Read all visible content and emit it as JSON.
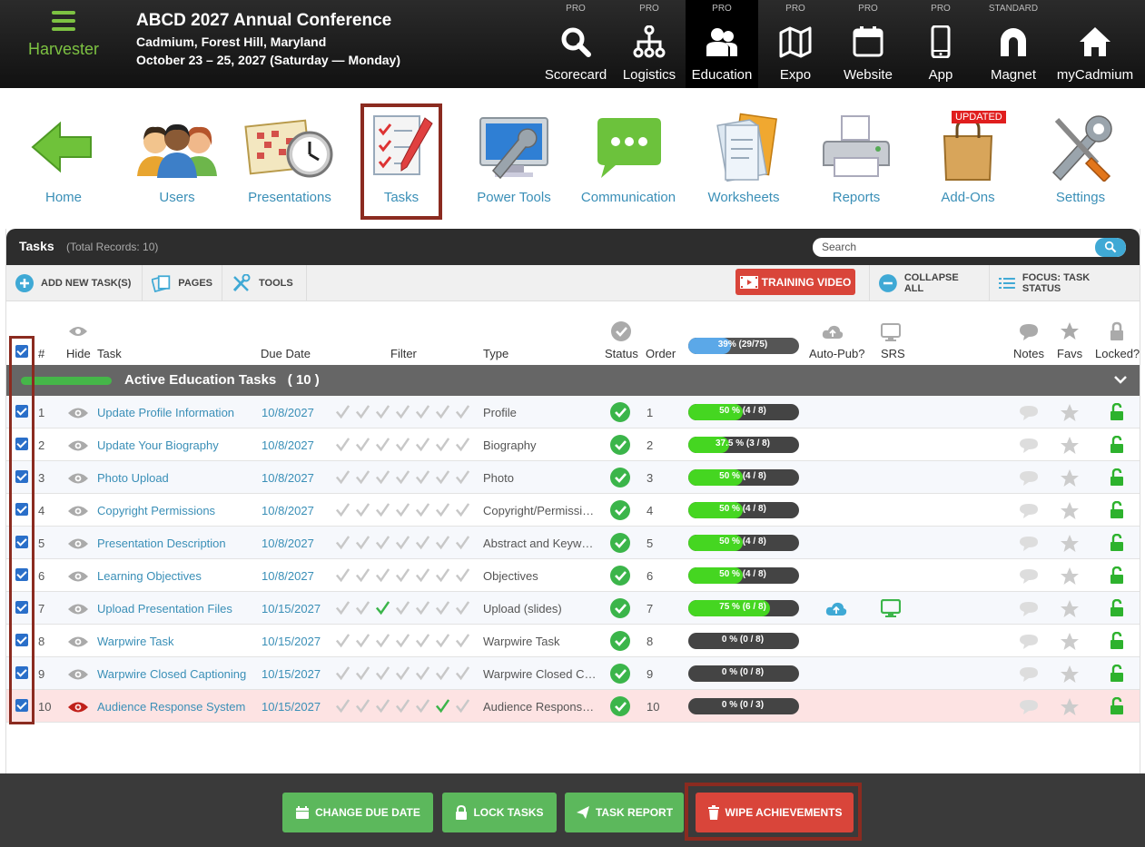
{
  "app": {
    "name": "Harvester"
  },
  "conference": {
    "title": "ABCD 2027 Annual Conference",
    "location": "Cadmium, Forest Hill, Maryland",
    "dates": "October 23 – 25, 2027 (Saturday — Monday)"
  },
  "modules": [
    {
      "tier": "PRO",
      "label": "Scorecard",
      "icon": "search-icon"
    },
    {
      "tier": "PRO",
      "label": "Logistics",
      "icon": "org-chart-icon"
    },
    {
      "tier": "PRO",
      "label": "Education",
      "icon": "people-icon"
    },
    {
      "tier": "PRO",
      "label": "Expo",
      "icon": "map-icon"
    },
    {
      "tier": "PRO",
      "label": "Website",
      "icon": "browser-icon"
    },
    {
      "tier": "PRO",
      "label": "App",
      "icon": "phone-icon"
    },
    {
      "tier": "STANDARD",
      "label": "Magnet",
      "icon": "magnet-icon"
    },
    {
      "tier": "",
      "label": "myCadmium",
      "icon": "home-icon"
    }
  ],
  "nav": [
    {
      "label": "Home"
    },
    {
      "label": "Users"
    },
    {
      "label": "Presentations"
    },
    {
      "label": "Tasks"
    },
    {
      "label": "Power Tools"
    },
    {
      "label": "Communication"
    },
    {
      "label": "Worksheets"
    },
    {
      "label": "Reports"
    },
    {
      "label": "Add-Ons",
      "badge": "UPDATED"
    },
    {
      "label": "Settings"
    }
  ],
  "panel": {
    "title": "Tasks",
    "count": "(Total Records: 10)",
    "search_placeholder": "Search"
  },
  "toolbar": {
    "add": "ADD NEW TASK(S)",
    "pages": "PAGES",
    "tools": "TOOLS",
    "training": "TRAINING VIDEO",
    "collapse": "COLLAPSE ALL",
    "focus": "FOCUS: TASK STATUS"
  },
  "columns": {
    "num": "#",
    "hide": "Hide",
    "task": "Task",
    "due": "Due Date",
    "filter": "Filter",
    "type": "Type",
    "status": "Status",
    "order": "Order",
    "overall": "39% (29/75)",
    "overall_fraction": 0.39,
    "autopub": "Auto-Pub?",
    "srs": "SRS",
    "notes": "Notes",
    "favs": "Favs",
    "locked": "Locked?"
  },
  "group": {
    "title": "Active Education Tasks",
    "count": "( 10 )"
  },
  "rows": [
    {
      "num": "1",
      "task": "Update Profile Information",
      "due": "10/8/2027",
      "type": "Profile",
      "order": "1",
      "progress": "50 % (4 / 8)",
      "fraction": 0.5,
      "green_filter": -1
    },
    {
      "num": "2",
      "task": "Update Your Biography",
      "due": "10/8/2027",
      "type": "Biography",
      "order": "2",
      "progress": "37.5 % (3 / 8)",
      "fraction": 0.375,
      "green_filter": -1
    },
    {
      "num": "3",
      "task": "Photo Upload",
      "due": "10/8/2027",
      "type": "Photo",
      "order": "3",
      "progress": "50 % (4 / 8)",
      "fraction": 0.5,
      "green_filter": -1
    },
    {
      "num": "4",
      "task": "Copyright Permissions",
      "due": "10/8/2027",
      "type": "Copyright/Permissio...",
      "order": "4",
      "progress": "50 % (4 / 8)",
      "fraction": 0.5,
      "green_filter": -1
    },
    {
      "num": "5",
      "task": "Presentation Description",
      "due": "10/8/2027",
      "type": "Abstract and Keywo...",
      "order": "5",
      "progress": "50 % (4 / 8)",
      "fraction": 0.5,
      "green_filter": -1
    },
    {
      "num": "6",
      "task": "Learning Objectives",
      "due": "10/8/2027",
      "type": "Objectives",
      "order": "6",
      "progress": "50 % (4 / 8)",
      "fraction": 0.5,
      "green_filter": -1
    },
    {
      "num": "7",
      "task": "Upload Presentation Files",
      "due": "10/15/2027",
      "type": "Upload (slides)",
      "order": "7",
      "progress": "75 % (6 / 8)",
      "fraction": 0.75,
      "green_filter": 2,
      "autopub": true,
      "srs": true
    },
    {
      "num": "8",
      "task": "Warpwire Task",
      "due": "10/15/2027",
      "type": "Warpwire Task",
      "order": "8",
      "progress": "0 % (0 / 8)",
      "fraction": 0,
      "green_filter": -1
    },
    {
      "num": "9",
      "task": "Warpwire Closed Captioning",
      "due": "10/15/2027",
      "type": "Warpwire Closed Ca...",
      "order": "9",
      "progress": "0 % (0 / 8)",
      "fraction": 0,
      "green_filter": -1
    },
    {
      "num": "10",
      "task": "Audience Response System",
      "due": "10/15/2027",
      "type": "Audience Response ...",
      "order": "10",
      "progress": "0 % (0 / 3)",
      "fraction": 0,
      "green_filter": 5,
      "hidden": true
    }
  ],
  "actions": {
    "change_due": "CHANGE DUE DATE",
    "lock": "LOCK TASKS",
    "report": "TASK REPORT",
    "wipe": "WIPE ACHIEVEMENTS"
  },
  "colors": {
    "accent_green": "#7dc242",
    "link_blue": "#3a8fb7",
    "progress_green": "#45d621",
    "danger_red": "#d9453a"
  }
}
